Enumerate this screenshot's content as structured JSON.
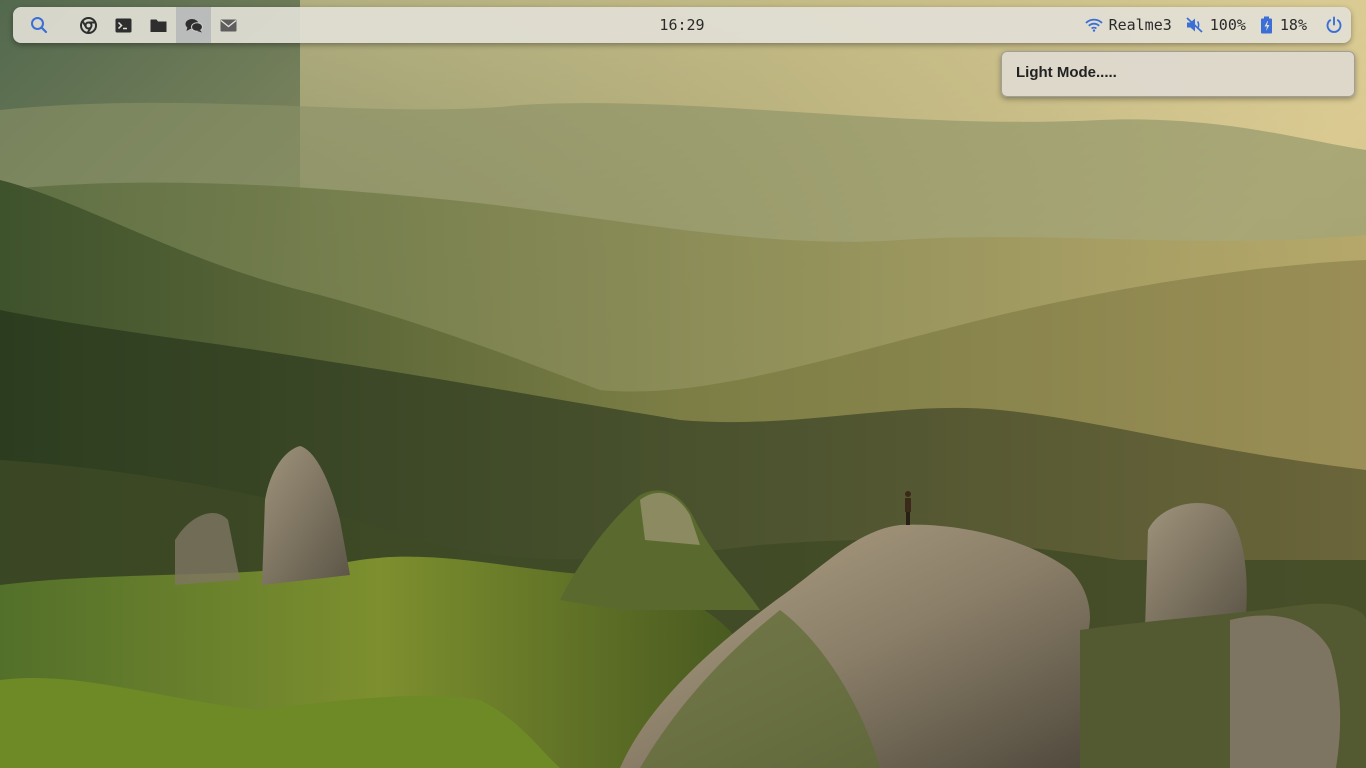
{
  "topbar": {
    "launchers": [
      {
        "name": "search-icon",
        "label": "Search"
      },
      {
        "name": "chrome-icon",
        "label": "Chrome"
      },
      {
        "name": "terminal-icon",
        "label": "Terminal"
      },
      {
        "name": "folder-icon",
        "label": "Files"
      },
      {
        "name": "chat-icon",
        "label": "Chat"
      },
      {
        "name": "mail-icon",
        "label": "Mail"
      }
    ],
    "active_launcher": "chat-icon",
    "clock": "16:29",
    "wifi": {
      "icon": "wifi-icon",
      "ssid": "Realme3"
    },
    "volume": {
      "icon": "volume-muted-icon",
      "level": "100%"
    },
    "battery": {
      "icon": "battery-charging-icon",
      "level": "18%"
    },
    "power": {
      "icon": "power-icon"
    }
  },
  "popup": {
    "text": "Light Mode....."
  },
  "colors": {
    "icon_accent": "#3b6fd6",
    "icon_dark": "#2e2e2e",
    "bar_bg": "#e2dfd6",
    "popup_bg": "#ded9cd"
  }
}
